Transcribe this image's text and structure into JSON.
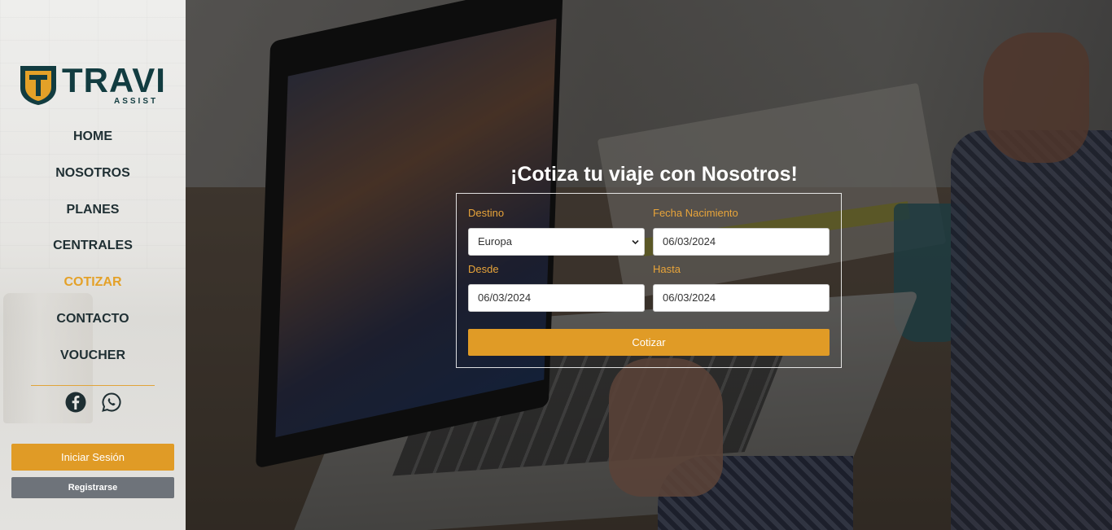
{
  "brand": {
    "name": "TRAVI",
    "tagline": "ASSIST",
    "primary_color": "#123c40",
    "accent_color": "#e09b26"
  },
  "nav": {
    "items": [
      {
        "label": "HOME",
        "active": false
      },
      {
        "label": "NOSOTROS",
        "active": false
      },
      {
        "label": "PLANES",
        "active": false
      },
      {
        "label": "CENTRALES",
        "active": false
      },
      {
        "label": "COTIZAR",
        "active": true
      },
      {
        "label": "CONTACTO",
        "active": false
      },
      {
        "label": "VOUCHER",
        "active": false
      }
    ]
  },
  "socials": {
    "icons": [
      "facebook-icon",
      "whatsapp-icon"
    ]
  },
  "auth": {
    "login_label": "Iniciar Sesión",
    "register_label": "Registrarse"
  },
  "quote": {
    "title": "¡Cotiza tu viaje con Nosotros!",
    "destino_label": "Destino",
    "destino_value": "Europa",
    "fecha_nacimiento_label": "Fecha Nacimiento",
    "fecha_nacimiento_value": "06/03/2024",
    "desde_label": "Desde",
    "desde_value": "06/03/2024",
    "hasta_label": "Hasta",
    "hasta_value": "06/03/2024",
    "submit_label": "Cotizar"
  }
}
